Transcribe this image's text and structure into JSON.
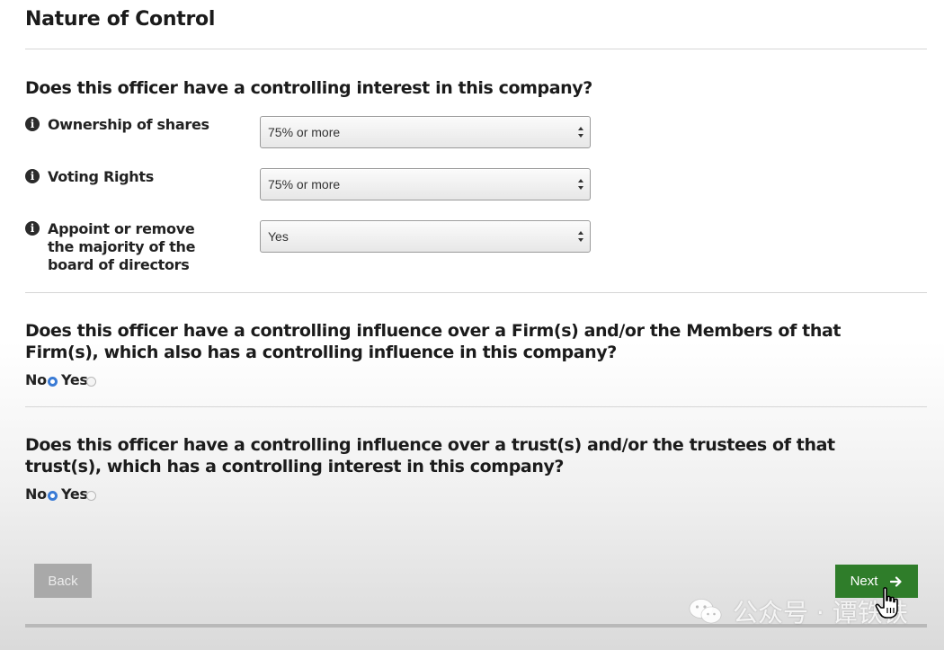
{
  "section": {
    "title": "Nature of Control"
  },
  "controlling_interest": {
    "question": "Does this officer have a controlling interest in this company?",
    "fields": [
      {
        "label": "Ownership of shares",
        "value": "75% or more",
        "icon": "info-icon"
      },
      {
        "label": "Voting Rights",
        "value": "75% or more",
        "icon": "info-icon"
      },
      {
        "label": "Appoint or remove the majority of the board of directors",
        "value": "Yes",
        "icon": "info-icon"
      }
    ]
  },
  "firm_influence": {
    "question": "Does this officer have a controlling influence over a Firm(s) and/or the Members of that Firm(s), which also has a controlling influence in this company?",
    "no_label": "No",
    "yes_label": "Yes",
    "selected": "No"
  },
  "trust_influence": {
    "question": "Does this officer have a controlling influence over a trust(s) and/or the trustees of that trust(s), which has a controlling interest in this company?",
    "no_label": "No",
    "yes_label": "Yes",
    "selected": "No"
  },
  "nav": {
    "back_label": "Back",
    "next_label": "Next",
    "next_icon": "arrow-right-icon"
  },
  "watermark": {
    "icon": "wechat-icon",
    "text": "公众号 · 谭铁铁"
  },
  "colors": {
    "next_button": "#2f7d2a",
    "back_button": "#a9a9a9",
    "radio_checked": "#3a7bd5",
    "info_icon": "#2b2b2b"
  }
}
